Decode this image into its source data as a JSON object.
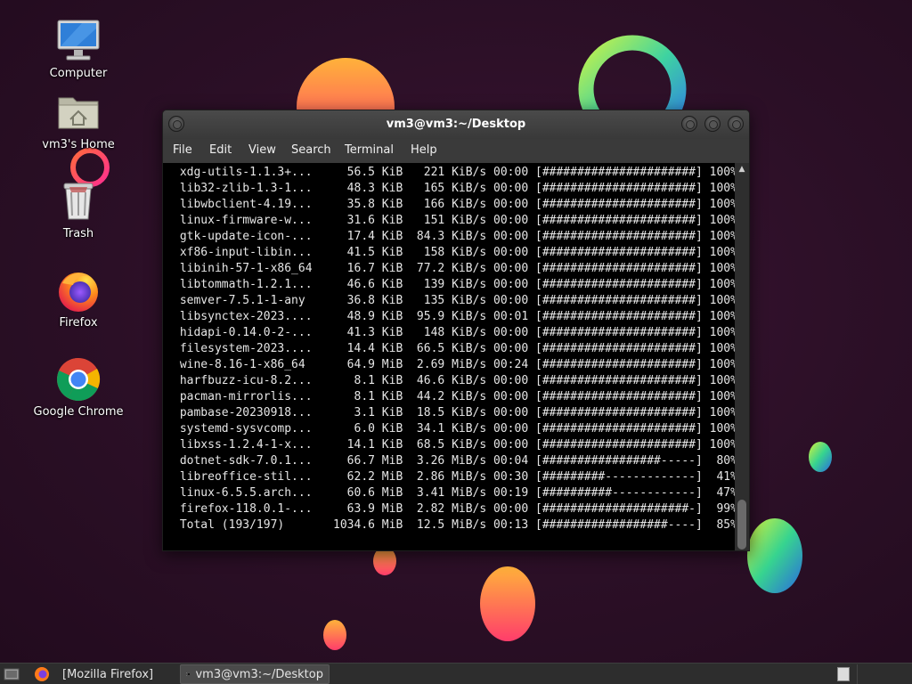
{
  "desktop": {
    "icons": [
      {
        "label": "Computer",
        "icon": "computer-icon"
      },
      {
        "label": "vm3's Home",
        "icon": "home-folder-icon"
      },
      {
        "label": "Trash",
        "icon": "trash-icon"
      },
      {
        "label": "Firefox",
        "icon": "firefox-icon"
      },
      {
        "label": "Google Chrome",
        "icon": "chrome-icon"
      }
    ]
  },
  "terminal": {
    "title": "vm3@vm3:~/Desktop",
    "menu": [
      "File",
      "Edit",
      "View",
      "Search",
      "Terminal",
      "Help"
    ],
    "lines": [
      " xdg-utils-1.1.3+...     56.5 KiB   221 KiB/s 00:00 [######################] 100%",
      " lib32-zlib-1.3-1...     48.3 KiB   165 KiB/s 00:00 [######################] 100%",
      " libwbclient-4.19...     35.8 KiB   166 KiB/s 00:00 [######################] 100%",
      " linux-firmware-w...     31.6 KiB   151 KiB/s 00:00 [######################] 100%",
      " gtk-update-icon-...     17.4 KiB  84.3 KiB/s 00:00 [######################] 100%",
      " xf86-input-libin...     41.5 KiB   158 KiB/s 00:00 [######################] 100%",
      " libinih-57-1-x86_64     16.7 KiB  77.2 KiB/s 00:00 [######################] 100%",
      " libtommath-1.2.1...     46.6 KiB   139 KiB/s 00:00 [######################] 100%",
      " semver-7.5.1-1-any      36.8 KiB   135 KiB/s 00:00 [######################] 100%",
      " libsynctex-2023....     48.9 KiB  95.9 KiB/s 00:01 [######################] 100%",
      " hidapi-0.14.0-2-...     41.3 KiB   148 KiB/s 00:00 [######################] 100%",
      " filesystem-2023....     14.4 KiB  66.5 KiB/s 00:00 [######################] 100%",
      " wine-8.16-1-x86_64      64.9 MiB  2.69 MiB/s 00:24 [######################] 100%",
      " harfbuzz-icu-8.2...      8.1 KiB  46.6 KiB/s 00:00 [######################] 100%",
      " pacman-mirrorlis...      8.1 KiB  44.2 KiB/s 00:00 [######################] 100%",
      " pambase-20230918...      3.1 KiB  18.5 KiB/s 00:00 [######################] 100%",
      " systemd-sysvcomp...      6.0 KiB  34.1 KiB/s 00:00 [######################] 100%",
      " libxss-1.2.4-1-x...     14.1 KiB  68.5 KiB/s 00:00 [######################] 100%",
      " dotnet-sdk-7.0.1...     66.7 MiB  3.26 MiB/s 00:04 [#################-----]  80%",
      " libreoffice-stil...     62.2 MiB  2.86 MiB/s 00:30 [#########-------------]  41%",
      " linux-6.5.5.arch...     60.6 MiB  3.41 MiB/s 00:19 [##########------------]  47%",
      " firefox-118.0.1-...     63.9 MiB  2.82 MiB/s 00:00 [#####################-]  99%",
      " Total (193/197)       1034.6 MiB  12.5 MiB/s 00:13 [##################----]  85%"
    ]
  },
  "taskbar": {
    "tasks": [
      {
        "label": "[Mozilla Firefox]",
        "icon": "firefox-icon",
        "active": false
      },
      {
        "label": "vm3@vm3:~/Desktop",
        "icon": "terminal-icon",
        "active": true
      }
    ]
  },
  "colors": {
    "background": "#2a0f24",
    "terminal_bg": "#000000",
    "terminal_fg": "#e6e6e6",
    "taskbar_bg": "#2d2d2d"
  }
}
